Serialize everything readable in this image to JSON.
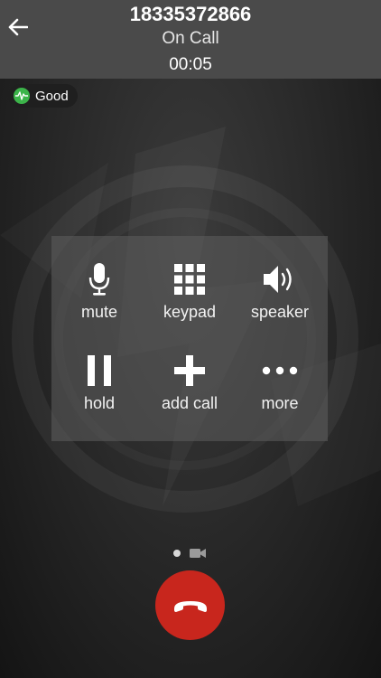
{
  "header": {
    "caller_number": "18335372866",
    "call_status": "On Call",
    "timer": "00:05"
  },
  "connection_quality": {
    "label": "Good",
    "color": "#3cb44a"
  },
  "controls": {
    "mute": {
      "label": "mute",
      "icon": "microphone-icon"
    },
    "keypad": {
      "label": "keypad",
      "icon": "keypad-grid-icon"
    },
    "speaker": {
      "label": "speaker",
      "icon": "speaker-icon"
    },
    "hold": {
      "label": "hold",
      "icon": "pause-icon"
    },
    "add_call": {
      "label": "add call",
      "icon": "plus-icon"
    },
    "more": {
      "label": "more",
      "icon": "more-dots-icon"
    }
  },
  "pager": {
    "pages": [
      "controls",
      "video"
    ],
    "active_page": 1
  },
  "end_call": {
    "icon": "hang-up-icon",
    "color": "#c8261d"
  },
  "colors": {
    "header_bg": "#4a4a4a",
    "panel_bg": "#5f5f5f"
  }
}
